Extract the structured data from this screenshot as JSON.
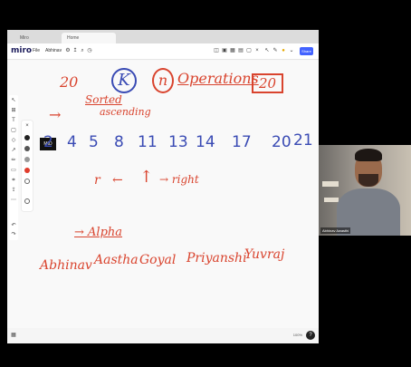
{
  "browser": {
    "tabs": [
      "Miro",
      "Home"
    ]
  },
  "toolbar": {
    "logo": "miro",
    "file_menu": "File",
    "board_name": "Abhinav",
    "share_label": "Share"
  },
  "board": {
    "annotations": {
      "top_20": "20",
      "circled_k": "K",
      "circled_n": "n",
      "operation": "Operations",
      "boxed_20": "20",
      "sorted": "Sorted",
      "ascending": "ascending",
      "arrow_right": "→",
      "right_label": "→ right",
      "up_arrow": "↑",
      "left_arrow": "←",
      "small_r": "r",
      "alpha": "→ Alpha",
      "names": [
        "Abhinav",
        "Aastha",
        "Goyal",
        "Priyanshi",
        "Yuvraj"
      ]
    },
    "numbers": [
      "2",
      "4",
      "5",
      "8",
      "11",
      "13",
      "14",
      "17",
      "20",
      "21"
    ],
    "mid_marker": "MID"
  },
  "footer": {
    "zoom": "100%",
    "help": "?"
  },
  "video": {
    "participant_name": "Abhinav Awasthi"
  }
}
